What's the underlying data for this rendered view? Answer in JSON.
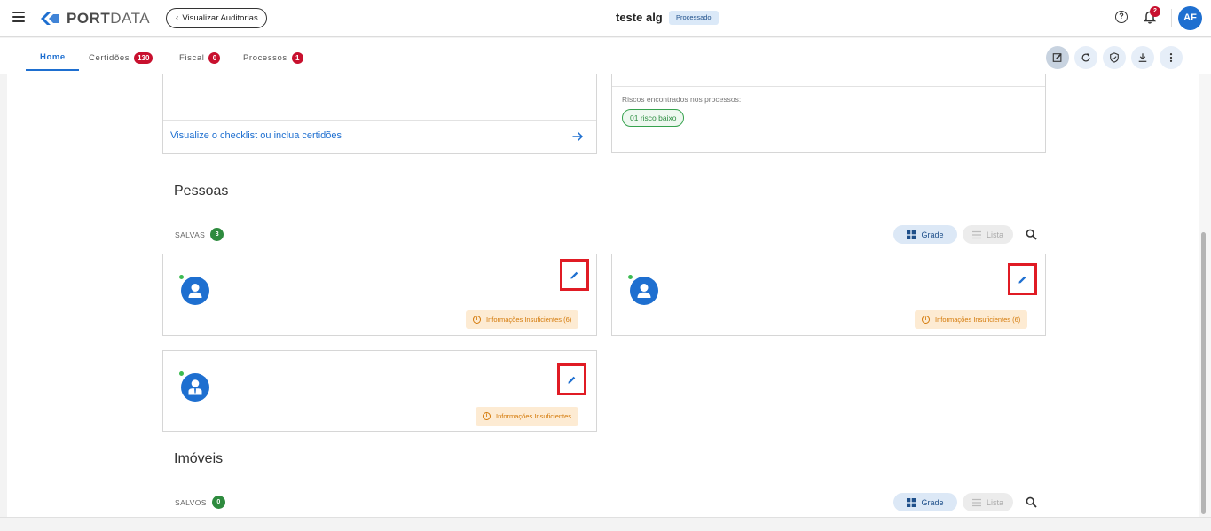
{
  "header": {
    "logo_bold": "PORT",
    "logo_light": "DATA",
    "back_label": "Visualizar Auditorias",
    "title": "teste alg",
    "status": "Processado",
    "notifications_count": "2",
    "user_initials": "AF"
  },
  "tabs": [
    {
      "label": "Home",
      "badge": ""
    },
    {
      "label": "Certidões",
      "badge": "130"
    },
    {
      "label": "Fiscal",
      "badge": "0"
    },
    {
      "label": "Processos",
      "badge": "1"
    }
  ],
  "toolbar_icons": [
    "edit-note-icon",
    "refresh-icon",
    "shield-check-icon",
    "download-icon",
    "more-vert-icon"
  ],
  "certidoes_card": {
    "link": "Visualize o checklist ou inclua certidões"
  },
  "processos_card": {
    "risk_label": "Riscos encontrados nos processos:",
    "risk_chip": "01 risco baixo"
  },
  "pessoas": {
    "title": "Pessoas",
    "saved_label": "SALVAS",
    "saved_count": "3",
    "grid_label": "Grade",
    "list_label": "Lista",
    "cards": [
      {
        "warning": "Informações Insuficientes (6)",
        "avatar": "person-icon"
      },
      {
        "warning": "Informações Insuficientes (6)",
        "avatar": "person-icon"
      },
      {
        "warning": "Informações Insuficientes",
        "avatar": "business-person-icon"
      }
    ]
  },
  "imoveis": {
    "title": "Imóveis",
    "saved_label": "SALVOS",
    "saved_count": "0",
    "grid_label": "Grade",
    "list_label": "Lista"
  },
  "colors": {
    "primary": "#1e6fd0",
    "danger_badge": "#c8102e",
    "success": "#2e8b3e",
    "warning_bg": "#fdebd3",
    "warning_text": "#d47a0a",
    "highlight_box": "#e01b24"
  }
}
